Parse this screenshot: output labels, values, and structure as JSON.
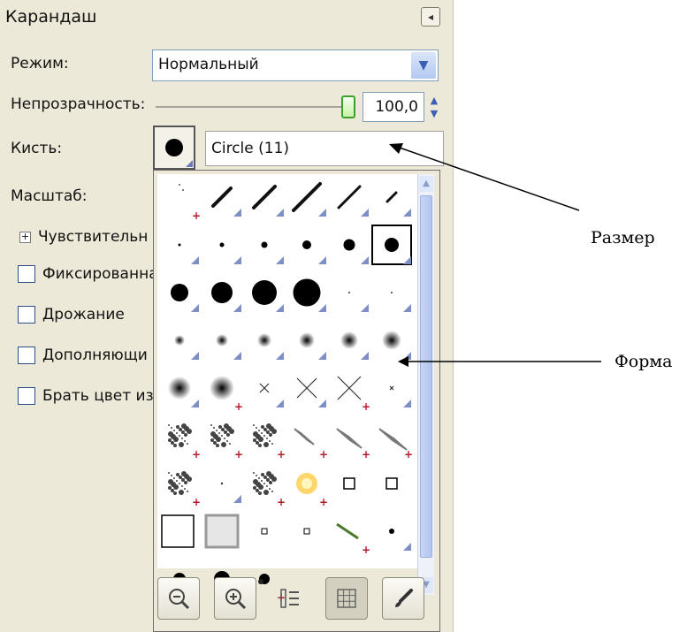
{
  "panel": {
    "title": "Карандаш",
    "mode_label": "Режим:",
    "mode_value": "Нормальный",
    "opacity_label": "Непрозрачность:",
    "opacity_value": "100,0",
    "opacity_level_percent": 100,
    "brush_label": "Кисть:",
    "brush_name": "Circle (11)",
    "scale_label": "Масштаб:",
    "sensitivity_label": "Чувствительн",
    "options": [
      {
        "label": "Фиксированна"
      },
      {
        "label": "Дрожание"
      },
      {
        "label": "Дополняющи"
      },
      {
        "label": "Брать цвет из"
      }
    ]
  },
  "popup": {
    "brushes": [
      "small splatter",
      "thin stroke",
      "medium stroke",
      "long stroke",
      "calligraphy stroke",
      "short stroke",
      "circle 1",
      "circle 3",
      "circle 5",
      "circle 7",
      "circle 9",
      "circle 11",
      "circle 13",
      "circle 15",
      "circle 17",
      "circle 19",
      "dot tiny",
      "dot tiny 2",
      "fuzzy 1",
      "fuzzy 3",
      "fuzzy 5",
      "fuzzy 7",
      "fuzzy 9",
      "fuzzy 11",
      "fuzzy 13",
      "galaxy",
      "cross small",
      "cross medium",
      "cross large",
      "cross tiny",
      "confetti",
      "texture noise",
      "sparks",
      "hatch small",
      "hatch medium",
      "hatch large",
      "pepper",
      "dot small",
      "hatch texture",
      "sponge star",
      "square outline small",
      "square outline medium",
      "square large",
      "square fuzzy",
      "square tiny",
      "square tiny 2",
      "vine",
      "star dot",
      "blot 1",
      "blot 2",
      "blot 3"
    ],
    "toolbar": [
      "zoom-out",
      "zoom-in",
      "list-view",
      "grid-view",
      "edit-brush"
    ]
  },
  "annotations": {
    "size_label": "Размер",
    "shape_label": "Форма"
  }
}
